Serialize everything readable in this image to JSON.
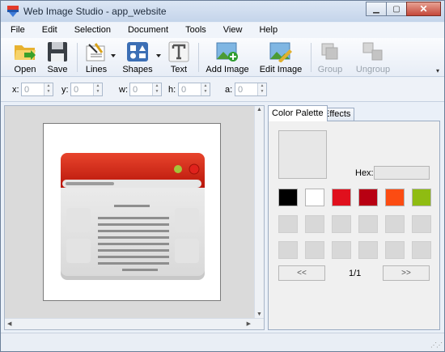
{
  "window": {
    "title": "Web Image Studio - app_website"
  },
  "menubar": {
    "items": [
      "File",
      "Edit",
      "Selection",
      "Document",
      "Tools",
      "View",
      "Help"
    ]
  },
  "toolbar": {
    "open": "Open",
    "save": "Save",
    "lines": "Lines",
    "shapes": "Shapes",
    "text": "Text",
    "add_image": "Add Image",
    "edit_image": "Edit Image",
    "group": "Group",
    "ungroup": "Ungroup"
  },
  "coords": {
    "x_label": "x:",
    "x_value": "0",
    "y_label": "y:",
    "y_value": "0",
    "w_label": "w:",
    "w_value": "0",
    "h_label": "h:",
    "h_value": "0",
    "a_label": "a:",
    "a_value": "0"
  },
  "panel": {
    "tabs": [
      "Color Palette",
      "Effects"
    ],
    "hex_label": "Hex:",
    "hex_value": "",
    "swatches_row1": [
      "#000000",
      "#ffffff",
      "#e0101d",
      "#b80012",
      "#fc4c12",
      "#8fbc12"
    ],
    "empty_swatch_color": "#d8d8d8",
    "prev_label": "<<",
    "next_label": ">>",
    "page_indicator": "1/1"
  },
  "colors": {
    "accent_red": "#d6230f",
    "window_bg": "#eaf0f8"
  }
}
